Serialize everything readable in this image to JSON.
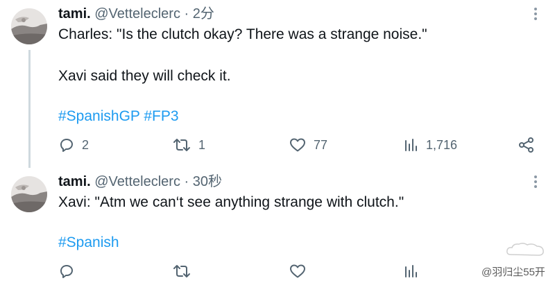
{
  "tweets": [
    {
      "name": "tami.",
      "handle": "@Vetteleclerc",
      "separator": "·",
      "time": "2分",
      "lines": [
        "Charles: \"Is the clutch okay? There was a strange noise.\"",
        "Xavi said they will check it."
      ],
      "hashtags": [
        "#SpanishGP",
        "#FP3"
      ],
      "actions": {
        "reply_count": "2",
        "retweet_count": "1",
        "like_count": "77",
        "views_count": "1,716"
      }
    },
    {
      "name": "tami.",
      "handle": "@Vetteleclerc",
      "separator": "·",
      "time": "30秒",
      "lines": [
        "Xavi: \"Atm we can‘t see anything strange with clutch.\""
      ],
      "hashtags": [
        "#Spanish"
      ],
      "actions": {
        "reply_count": "",
        "retweet_count": "",
        "like_count": "",
        "views_count": ""
      }
    }
  ],
  "watermark": {
    "text": "@羽归尘55开"
  },
  "icons": {
    "more": "more-dots-icon",
    "reply": "reply-icon",
    "retweet": "retweet-icon",
    "like": "heart-icon",
    "views": "views-bars-icon",
    "share": "share-icon"
  },
  "colors": {
    "text": "#0f1419",
    "secondary": "#536471",
    "link": "#1d9bf0",
    "thread_line": "#cfd9de"
  }
}
